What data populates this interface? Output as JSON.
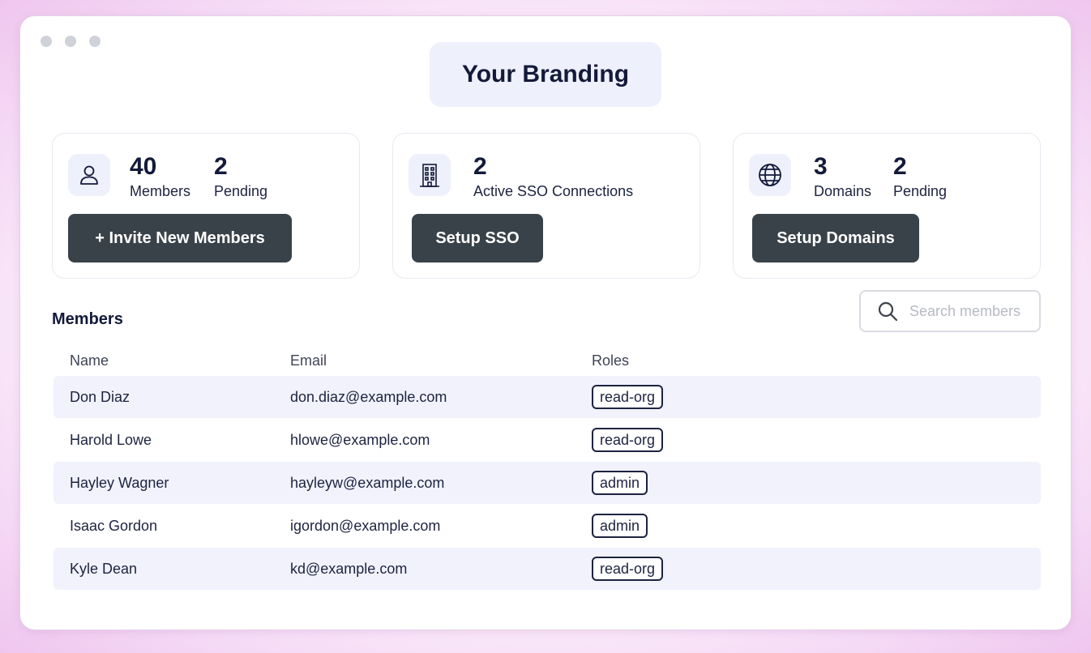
{
  "branding": {
    "title": "Your Branding"
  },
  "cards": {
    "members": {
      "icon": "user-icon",
      "stat1_value": "40",
      "stat1_label": "Members",
      "stat2_value": "2",
      "stat2_label": "Pending",
      "button": "+ Invite New Members"
    },
    "sso": {
      "icon": "building-icon",
      "stat1_value": "2",
      "stat1_label": "Active SSO Connections",
      "button": "Setup SSO"
    },
    "domains": {
      "icon": "globe-icon",
      "stat1_value": "3",
      "stat1_label": "Domains",
      "stat2_value": "2",
      "stat2_label": "Pending",
      "button": "Setup Domains"
    }
  },
  "members": {
    "title": "Members",
    "search_placeholder": "Search members",
    "search_icon": "search-icon",
    "columns": {
      "name": "Name",
      "email": "Email",
      "roles": "Roles"
    },
    "rows": [
      {
        "name": "Don Diaz",
        "email": "don.diaz@example.com",
        "role": "read-org"
      },
      {
        "name": "Harold Lowe",
        "email": "hlowe@example.com",
        "role": "read-org"
      },
      {
        "name": "Hayley Wagner",
        "email": "hayleyw@example.com",
        "role": "admin"
      },
      {
        "name": "Isaac Gordon",
        "email": "igordon@example.com",
        "role": "admin"
      },
      {
        "name": "Kyle Dean",
        "email": "kd@example.com",
        "role": "read-org"
      }
    ]
  },
  "colors": {
    "button_bg": "#3a4249",
    "text_dark": "#131a3a",
    "accent_bg": "#eef0fb",
    "row_shade": "#f1f2fb"
  }
}
